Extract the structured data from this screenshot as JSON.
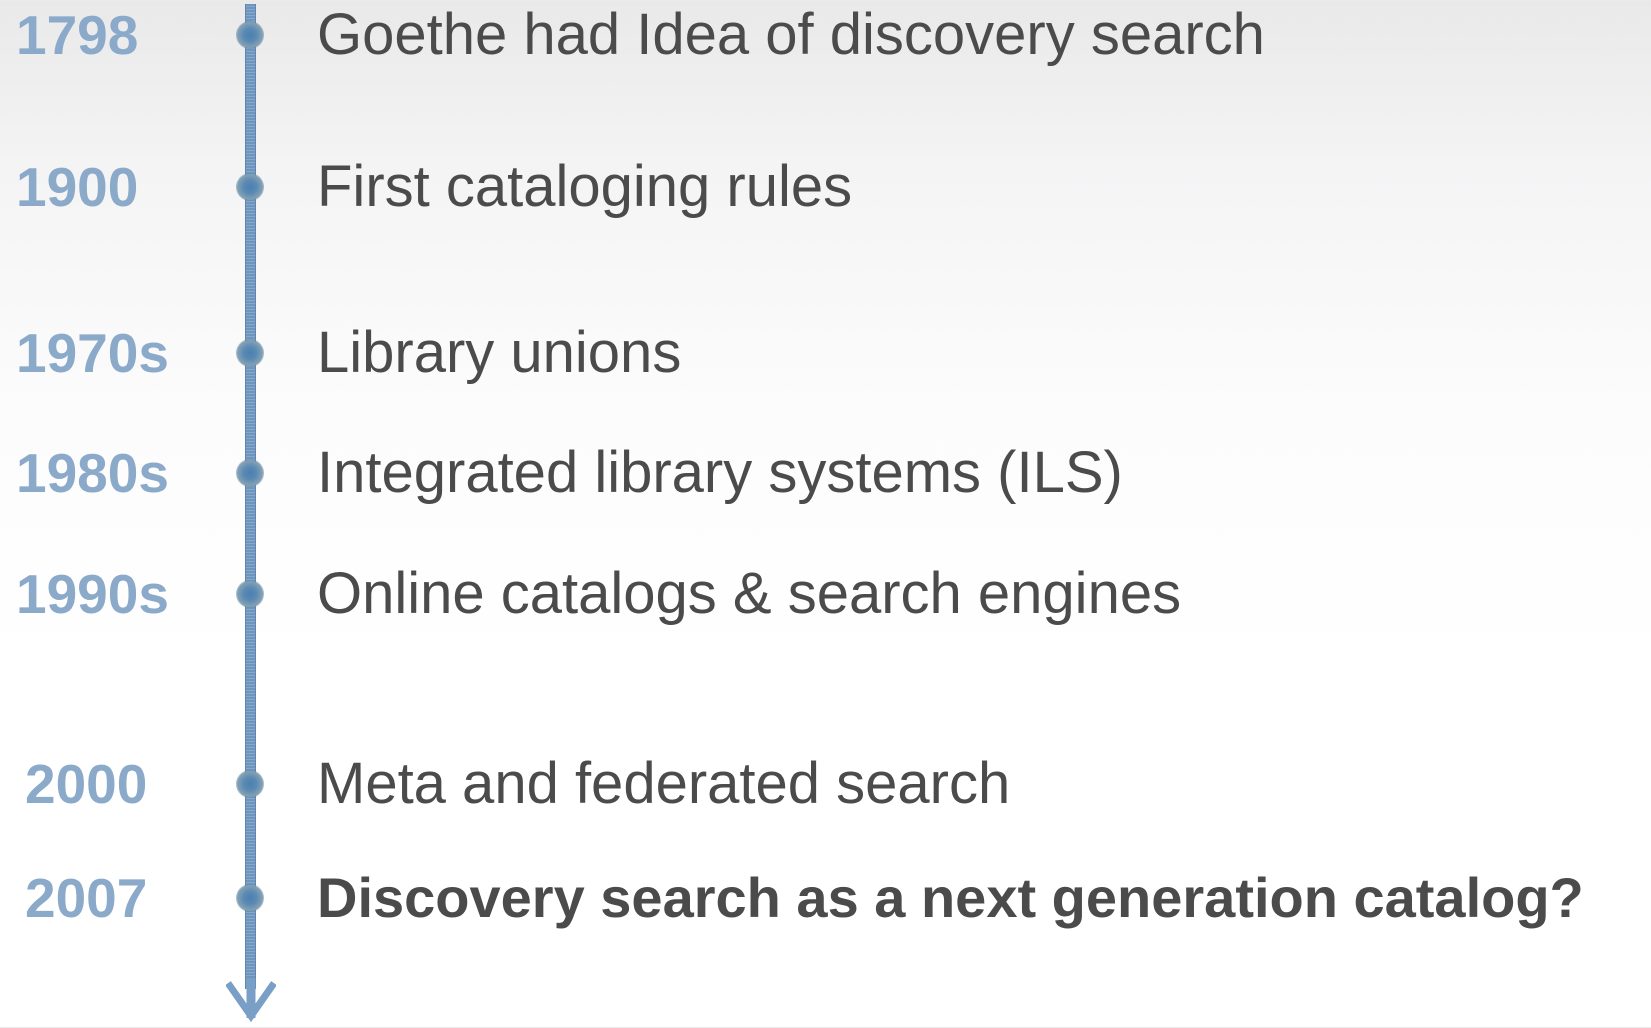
{
  "timeline": {
    "events": [
      {
        "year": "1798",
        "label": "Goethe had Idea of discovery search",
        "emphasized": false
      },
      {
        "year": "1900",
        "label": "First cataloging rules",
        "emphasized": false
      },
      {
        "year": "1970s",
        "label": "Library unions",
        "emphasized": false
      },
      {
        "year": "1980s",
        "label": "Integrated library systems (ILS)",
        "emphasized": false
      },
      {
        "year": "1990s",
        "label": "Online catalogs & search engines",
        "emphasized": false
      },
      {
        "year": "2000",
        "label": "Meta and federated search",
        "emphasized": false
      },
      {
        "year": "2007",
        "label": "Discovery search as a next generation catalog?",
        "emphasized": true
      }
    ],
    "colors": {
      "year_text": "#8ba9c9",
      "label_text": "#4b4b4b",
      "axis": "#6f95bd",
      "dot": "#5a89b4"
    }
  }
}
